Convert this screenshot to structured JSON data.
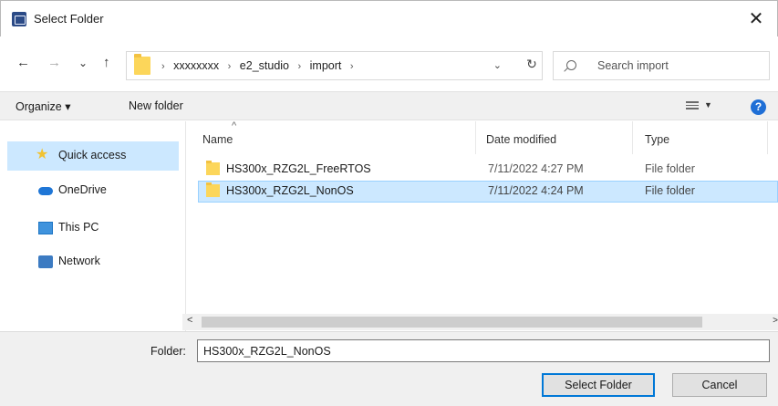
{
  "window": {
    "title": "Select Folder",
    "close_glyph": "✕"
  },
  "nav": {
    "back": "←",
    "forward": "→",
    "recent": "⌄",
    "up": "↑",
    "breadcrumb": [
      "xxxxxxxx",
      "e2_studio",
      "import"
    ],
    "separator": "›",
    "dropdown": "⌄",
    "refresh": "↻",
    "search_placeholder": "Search import"
  },
  "toolbar": {
    "organize": "Organize ▾",
    "new_folder": "New folder",
    "view_dd": "▼",
    "help": "?"
  },
  "sidebar": {
    "items": [
      {
        "label": "Quick access",
        "icon": "star-icon",
        "active": true
      },
      {
        "label": "OneDrive",
        "icon": "cloud-icon"
      },
      {
        "label": "This PC",
        "icon": "computer-icon"
      },
      {
        "label": "Network",
        "icon": "network-icon"
      }
    ]
  },
  "list": {
    "columns": [
      "Name",
      "Date modified",
      "Type"
    ],
    "sort_glyph": "^",
    "rows": [
      {
        "name": "HS300x_RZG2L_FreeRTOS",
        "date": "7/11/2022 4:27 PM",
        "type": "File folder",
        "selected": false
      },
      {
        "name": "HS300x_RZG2L_NonOS",
        "date": "7/11/2022 4:24 PM",
        "type": "File folder",
        "selected": true
      }
    ],
    "scroll_left": "<",
    "scroll_right": ">"
  },
  "footer": {
    "folder_label": "Folder:",
    "folder_value": "HS300x_RZG2L_NonOS",
    "select_button": "Select Folder",
    "cancel_button": "Cancel"
  }
}
